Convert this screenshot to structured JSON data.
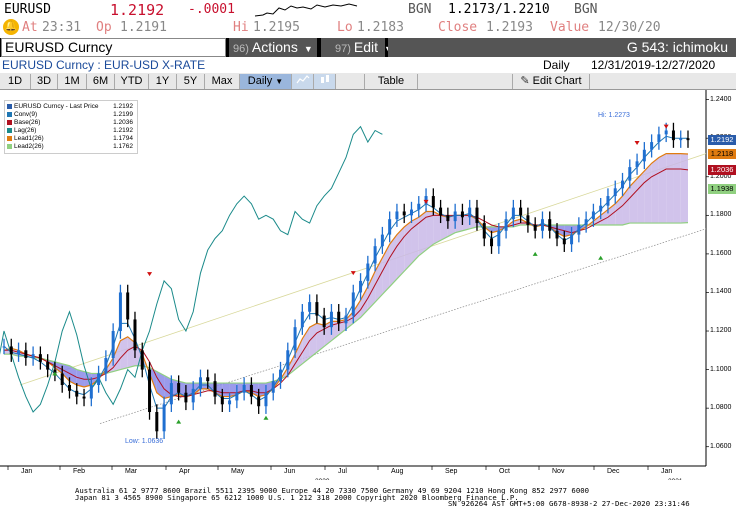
{
  "quote": {
    "ticker": "EURUSD",
    "last": "1.2192",
    "change": "-.0001",
    "bgn_label": "BGN",
    "bid_ask": "1.2173/1.2210",
    "bgn_label2": "BGN",
    "at_label": "At",
    "time": "23:31",
    "op_label": "Op",
    "open": "1.2191",
    "hi_label": "Hi",
    "high": "1.2195",
    "lo_label": "Lo",
    "low": "1.2183",
    "close_label": "Close",
    "close": "1.2193",
    "value_label": "Value",
    "value_date": "12/30/20",
    "bell_icon": "bell-icon"
  },
  "cmdbar": {
    "security": "EURUSD Curncy",
    "actions_num": "96)",
    "actions_label": "Actions",
    "edit_num": "97)",
    "edit_label": "Edit",
    "function_title": "G 543: ichimoku"
  },
  "infobar": {
    "left": "EURUSD Curncy : EUR-USD X-RATE",
    "period": "Daily",
    "range": "12/31/2019-12/27/2020"
  },
  "toolbar": {
    "buttons": [
      "1D",
      "3D",
      "1M",
      "6M",
      "YTD",
      "1Y",
      "5Y",
      "Max"
    ],
    "period_select": "Daily",
    "table": "Table",
    "edit_chart": "Edit Chart"
  },
  "legend": [
    {
      "name": "EURUSD Curncy - Last Price",
      "value": "1.2192",
      "color": "#2a5caa"
    },
    {
      "name": "Conv(9)",
      "value": "1.2199",
      "color": "#1f77b4"
    },
    {
      "name": "Base(26)",
      "value": "1.2036",
      "color": "#b01020"
    },
    {
      "name": "Lag(26)",
      "value": "1.2192",
      "color": "#1a8a8a"
    },
    {
      "name": "Lead1(26)",
      "value": "1.1794",
      "color": "#e07b10"
    },
    {
      "name": "Lead2(26)",
      "value": "1.1762",
      "color": "#90d080"
    }
  ],
  "tags": [
    {
      "text": "1.2192",
      "bg": "#2a5caa",
      "fg": "#ffffff"
    },
    {
      "text": "1.2118",
      "bg": "#e07b10",
      "fg": "#000000"
    },
    {
      "text": "1.2036",
      "bg": "#b01020",
      "fg": "#ffffff"
    },
    {
      "text": "1.1938",
      "bg": "#90d080",
      "fg": "#000000"
    }
  ],
  "chart_data": {
    "type": "line",
    "y_ticks": [
      "1.2400",
      "1.2200",
      "1.2000",
      "1.1800",
      "1.1600",
      "1.1400",
      "1.1200",
      "1.1000",
      "1.0800",
      "1.0600"
    ],
    "x_ticks": [
      "Jan",
      "Feb",
      "Mar",
      "Apr",
      "May",
      "Jun",
      "Jul",
      "Aug",
      "Sep",
      "Oct",
      "Nov",
      "Dec",
      "Jan"
    ],
    "year_labels": [
      "2020",
      "2021"
    ],
    "ylim": [
      1.05,
      1.245
    ],
    "high_note": "Hi: 1.2273",
    "low_note": "Low: 1.0636",
    "series": [
      {
        "name": "EURUSD Curncy - Last Price",
        "values": [
          1.112,
          1.108,
          1.11,
          1.106,
          1.108,
          1.104,
          1.1,
          1.098,
          1.092,
          1.089,
          1.086,
          1.085,
          1.092,
          1.098,
          1.106,
          1.12,
          1.14,
          1.126,
          1.11,
          1.1,
          1.078,
          1.068,
          1.082,
          1.093,
          1.088,
          1.083,
          1.09,
          1.096,
          1.094,
          1.086,
          1.082,
          1.084,
          1.088,
          1.092,
          1.086,
          1.081,
          1.088,
          1.094,
          1.1,
          1.11,
          1.122,
          1.13,
          1.135,
          1.128,
          1.122,
          1.13,
          1.124,
          1.128,
          1.14,
          1.146,
          1.155,
          1.164,
          1.17,
          1.178,
          1.182,
          1.18,
          1.183,
          1.186,
          1.19,
          1.184,
          1.18,
          1.177,
          1.182,
          1.179,
          1.184,
          1.176,
          1.168,
          1.164,
          1.172,
          1.178,
          1.184,
          1.18,
          1.175,
          1.172,
          1.178,
          1.172,
          1.168,
          1.165,
          1.17,
          1.175,
          1.178,
          1.182,
          1.185,
          1.19,
          1.194,
          1.198,
          1.205,
          1.208,
          1.214,
          1.218,
          1.222,
          1.224,
          1.219,
          1.22,
          1.219
        ]
      },
      {
        "name": "Conv(9)",
        "values": [
          1.112,
          1.109,
          1.108,
          1.107,
          1.106,
          1.104,
          1.101,
          1.098,
          1.094,
          1.09,
          1.088,
          1.087,
          1.09,
          1.095,
          1.102,
          1.112,
          1.124,
          1.124,
          1.116,
          1.106,
          1.092,
          1.08,
          1.08,
          1.086,
          1.088,
          1.086,
          1.088,
          1.092,
          1.092,
          1.088,
          1.085,
          1.085,
          1.087,
          1.089,
          1.087,
          1.084,
          1.086,
          1.091,
          1.097,
          1.105,
          1.114,
          1.123,
          1.129,
          1.129,
          1.126,
          1.127,
          1.126,
          1.127,
          1.134,
          1.142,
          1.15,
          1.158,
          1.165,
          1.172,
          1.177,
          1.179,
          1.181,
          1.183,
          1.186,
          1.184,
          1.181,
          1.179,
          1.18,
          1.18,
          1.181,
          1.178,
          1.172,
          1.168,
          1.17,
          1.175,
          1.18,
          1.18,
          1.177,
          1.174,
          1.176,
          1.174,
          1.17,
          1.167,
          1.169,
          1.173,
          1.176,
          1.18,
          1.183,
          1.187,
          1.191,
          1.195,
          1.201,
          1.205,
          1.21,
          1.214,
          1.218,
          1.221,
          1.22,
          1.22,
          1.22
        ]
      },
      {
        "name": "Base(26)",
        "values": [
          1.11,
          1.11,
          1.109,
          1.108,
          1.107,
          1.106,
          1.104,
          1.102,
          1.1,
          1.098,
          1.096,
          1.095,
          1.095,
          1.096,
          1.098,
          1.101,
          1.106,
          1.11,
          1.112,
          1.11,
          1.104,
          1.096,
          1.09,
          1.087,
          1.086,
          1.086,
          1.087,
          1.088,
          1.089,
          1.089,
          1.088,
          1.088,
          1.088,
          1.089,
          1.089,
          1.088,
          1.088,
          1.09,
          1.093,
          1.097,
          1.103,
          1.109,
          1.115,
          1.119,
          1.121,
          1.123,
          1.124,
          1.125,
          1.127,
          1.131,
          1.137,
          1.144,
          1.151,
          1.158,
          1.164,
          1.169,
          1.173,
          1.176,
          1.179,
          1.18,
          1.18,
          1.18,
          1.18,
          1.18,
          1.18,
          1.179,
          1.177,
          1.175,
          1.174,
          1.174,
          1.175,
          1.176,
          1.176,
          1.175,
          1.175,
          1.174,
          1.173,
          1.172,
          1.171,
          1.172,
          1.173,
          1.175,
          1.177,
          1.179,
          1.182,
          1.185,
          1.189,
          1.193,
          1.197,
          1.2,
          1.202,
          1.204,
          1.204,
          1.204,
          1.2036
        ]
      },
      {
        "name": "Lag(26)",
        "values": [
          1.104,
          1.094,
          1.09,
          1.1,
          1.12,
          1.108,
          1.096,
          1.086,
          1.078,
          1.082,
          1.092,
          1.104,
          1.12,
          1.13,
          1.118,
          1.102,
          1.09,
          1.096,
          1.088,
          1.082,
          1.09,
          1.1,
          1.096,
          1.11,
          1.12,
          1.134,
          1.146,
          1.142,
          1.126,
          1.12,
          1.13,
          1.15,
          1.162,
          1.168,
          1.172,
          1.18,
          1.186,
          1.19,
          1.186,
          1.178,
          1.18,
          1.178,
          1.172,
          1.17,
          1.182,
          1.178,
          1.176,
          1.185,
          1.19,
          1.194,
          1.202,
          1.21,
          1.222,
          1.226,
          1.218,
          1.224,
          1.222
        ]
      },
      {
        "name": "Lead1(26)",
        "values": [
          1.11,
          1.111,
          1.11,
          1.108,
          1.107,
          1.106,
          1.104,
          1.101,
          1.098,
          1.094,
          1.092,
          1.091,
          1.092,
          1.095,
          1.1,
          1.106,
          1.115,
          1.117,
          1.114,
          1.108,
          1.098,
          1.088,
          1.085,
          1.086,
          1.087,
          1.086,
          1.087,
          1.09,
          1.09,
          1.088,
          1.086,
          1.086,
          1.087,
          1.089,
          1.088,
          1.086,
          1.087,
          1.09,
          1.095,
          1.101,
          1.108,
          1.116,
          1.122,
          1.124,
          1.123,
          1.125,
          1.125,
          1.126,
          1.13,
          1.136,
          1.143,
          1.151,
          1.158,
          1.165,
          1.17,
          1.174,
          1.177,
          1.179,
          1.182,
          1.182,
          1.18,
          1.179,
          1.18,
          1.18,
          1.18,
          1.178,
          1.174,
          1.171,
          1.172,
          1.174,
          1.177,
          1.178,
          1.176,
          1.174,
          1.175,
          1.174,
          1.171,
          1.169,
          1.17,
          1.172,
          1.174,
          1.177,
          1.18,
          1.183,
          1.186,
          1.19,
          1.195,
          1.199,
          1.203,
          1.207,
          1.21,
          1.212,
          1.212,
          1.212,
          1.2118
        ]
      },
      {
        "name": "Lead2(26)",
        "values": [
          1.108,
          1.108,
          1.107,
          1.107,
          1.106,
          1.106,
          1.105,
          1.104,
          1.103,
          1.102,
          1.1,
          1.099,
          1.098,
          1.098,
          1.098,
          1.099,
          1.1,
          1.101,
          1.102,
          1.102,
          1.101,
          1.099,
          1.097,
          1.095,
          1.094,
          1.093,
          1.093,
          1.093,
          1.093,
          1.093,
          1.093,
          1.093,
          1.093,
          1.093,
          1.093,
          1.093,
          1.093,
          1.094,
          1.095,
          1.097,
          1.1,
          1.103,
          1.106,
          1.109,
          1.112,
          1.115,
          1.118,
          1.121,
          1.124,
          1.127,
          1.131,
          1.135,
          1.139,
          1.143,
          1.147,
          1.151,
          1.155,
          1.159,
          1.162,
          1.165,
          1.167,
          1.169,
          1.171,
          1.172,
          1.173,
          1.174,
          1.174,
          1.174,
          1.174,
          1.174,
          1.174,
          1.175,
          1.175,
          1.175,
          1.175,
          1.175,
          1.175,
          1.175,
          1.175,
          1.175,
          1.175,
          1.175,
          1.175,
          1.175,
          1.175,
          1.175,
          1.176,
          1.176,
          1.176,
          1.176,
          1.176,
          1.176,
          1.176,
          1.176,
          1.1762
        ]
      }
    ],
    "extra_cloud_x_end": 27
  },
  "footer": {
    "line1": "Australia 61 2 9777 8600 Brazil 5511 2395 9000 Europe 44 20 7330 7500 Germany 49 69 9204 1210 Hong Kong 852 2977 6000",
    "line2": "Japan 81 3 4565 8900        Singapore 65 6212 1000        U.S. 1 212 318 2000        Copyright 2020 Bloomberg Finance L.P.",
    "line3": "SN 926264 AST  GMT+5:00 G678-8938-2 27-Dec-2020 23:31:46"
  }
}
